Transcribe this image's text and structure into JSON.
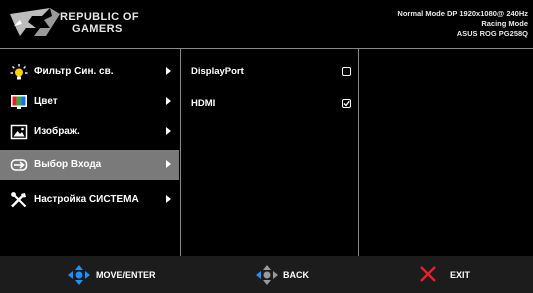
{
  "header": {
    "brand_line1": "REPUBLIC OF",
    "brand_line2": "GAMERS",
    "status_line1": "Normal Mode DP 1920x1080@ 240Hz",
    "status_line2": "Racing Mode",
    "status_line3": "ASUS ROG PG258Q"
  },
  "menu": {
    "items": [
      {
        "label": "Фильтр Син. св.",
        "icon": "bulb-icon"
      },
      {
        "label": "Цвет",
        "icon": "color-icon"
      },
      {
        "label": "Изображ.",
        "icon": "image-icon"
      },
      {
        "label": "Выбор Входа",
        "icon": "input-select-icon",
        "selected": true
      },
      {
        "label": "Настройка СИСТЕМА",
        "icon": "tools-icon"
      }
    ]
  },
  "submenu": {
    "items": [
      {
        "label": "DisplayPort",
        "checked": false
      },
      {
        "label": "HDMI",
        "checked": true
      }
    ]
  },
  "footer": {
    "move_label": "MOVE/ENTER",
    "back_label": "BACK",
    "exit_label": "EXIT"
  },
  "colors": {
    "accent_blue": "#1e90ff",
    "exit_red": "#e8202a",
    "selected_bg": "#7a7a7a"
  }
}
